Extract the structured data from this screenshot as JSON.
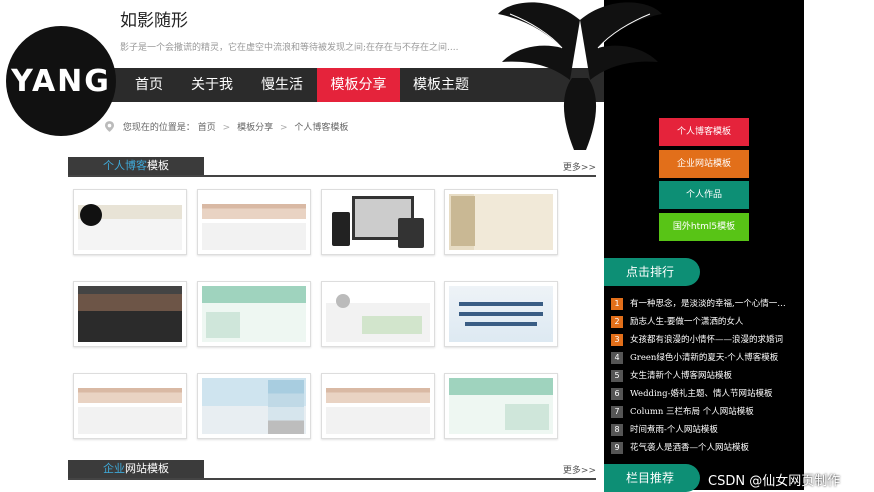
{
  "header": {
    "title": "如影随形",
    "motto": "影子是一个会撒谎的精灵，它在虚空中流浪和等待被发现之间;在存在与不存在之间....",
    "logo_text": "YANG"
  },
  "nav": {
    "items": [
      {
        "label": "首页"
      },
      {
        "label": "关于我"
      },
      {
        "label": "慢生活"
      },
      {
        "label": "模板分享"
      },
      {
        "label": "模板主题"
      }
    ],
    "active_index": 3,
    "active_color": "#e5233b"
  },
  "breadcrumb": {
    "prefix": "您现在的位置是：",
    "items": [
      "首页",
      "模板分享",
      "个人博客模板"
    ]
  },
  "sections": [
    {
      "title_hl": "个人博客",
      "title_rest": "模板",
      "more": "更多>>"
    },
    {
      "title_hl": "企业",
      "title_rest": "网站模板",
      "more": "更多>>"
    }
  ],
  "thumbs_alt": [
    "blog-template-1",
    "blog-template-2",
    "blog-template-3",
    "blog-template-4",
    "blog-template-5",
    "blog-template-6",
    "blog-template-7",
    "blog-template-8",
    "blog-template-9",
    "blog-template-10",
    "blog-template-11",
    "blog-template-12"
  ],
  "sidebar": {
    "buttons": [
      {
        "label": "个人博客模板",
        "color": "#e5233b"
      },
      {
        "label": "企业网站模板",
        "color": "#e26f1a"
      },
      {
        "label": "个人作品",
        "color": "#0d8f75"
      },
      {
        "label": "国外html5模板",
        "color": "#58c416"
      }
    ],
    "ranking_title": "点击排行",
    "ranking": [
      {
        "num": "1",
        "text": "有一种思念，是淡淡的幸福,一个心情一…"
      },
      {
        "num": "2",
        "text": "励志人生-要做一个潇洒的女人"
      },
      {
        "num": "3",
        "text": "女孩都有浪漫的小情怀——浪漫的求婚词"
      },
      {
        "num": "4",
        "text": "Green绿色小清新的夏天-个人博客模板"
      },
      {
        "num": "5",
        "text": "女生清新个人博客网站模板"
      },
      {
        "num": "6",
        "text": "Wedding-婚礼主题、情人节网站模板"
      },
      {
        "num": "7",
        "text": "Column 三栏布局 个人网站模板"
      },
      {
        "num": "8",
        "text": "时间煮雨-个人网站模板"
      },
      {
        "num": "9",
        "text": "花气袭人是酒香—个人网站模板"
      }
    ],
    "recommend_title": "栏目推荐"
  },
  "watermark": "CSDN @仙女网页制作"
}
